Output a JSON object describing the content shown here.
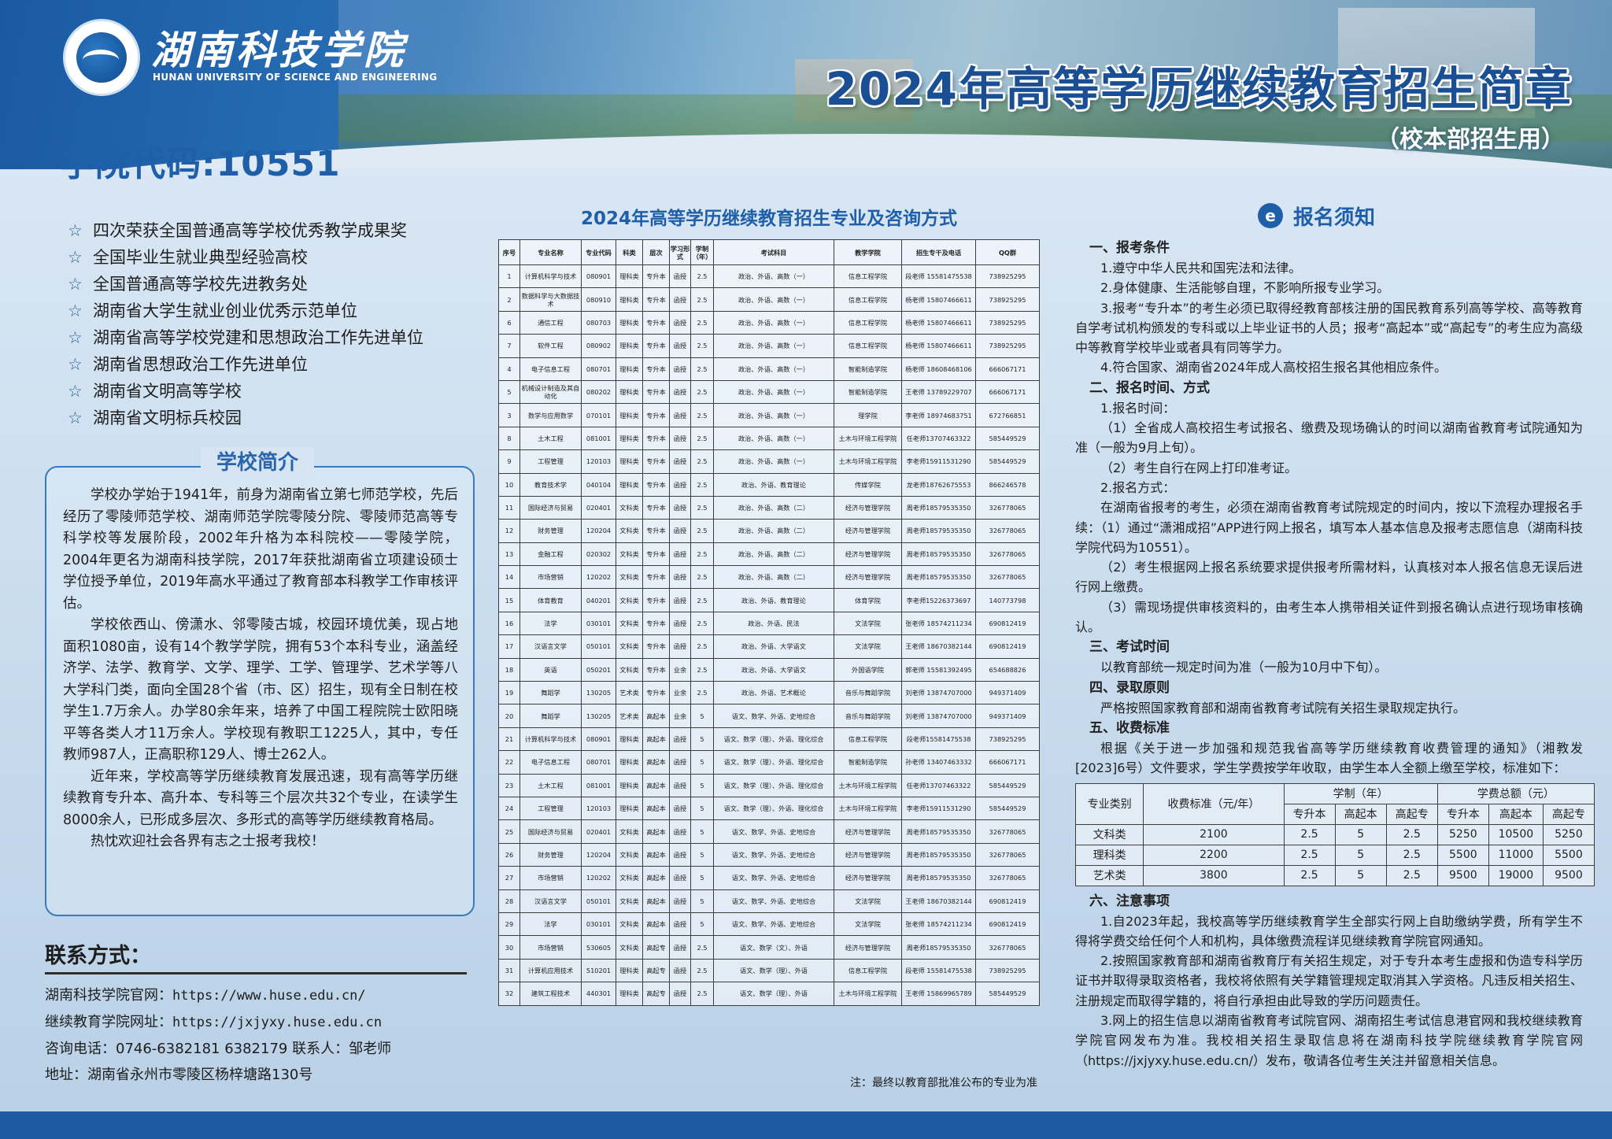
{
  "header": {
    "school_cn": "湖南科技学院",
    "school_en": "HUNAN UNIVERSITY OF SCIENCE AND ENGINEERING",
    "title": "2024年高等学历继续教育招生简章",
    "subtitle": "（校本部招生用）"
  },
  "left": {
    "code_title": "学院代码:10551",
    "honors": [
      "四次荣获全国普通高等学校优秀教学成果奖",
      "全国毕业生就业典型经验高校",
      "全国普通高等学校先进教务处",
      "湖南省大学生就业创业优秀示范单位",
      "湖南省高等学校党建和思想政治工作先进单位",
      "湖南省思想政治工作先进单位",
      "湖南省文明高等学校",
      "湖南省文明标兵校园"
    ],
    "intro_title": "学校简介",
    "intro_paragraphs": [
      "学校办学始于1941年，前身为湖南省立第七师范学校，先后经历了零陵师范学校、湖南师范学院零陵分院、零陵师范高等专科学校等发展阶段，2002年升格为本科院校——零陵学院，2004年更名为湖南科技学院，2017年获批湖南省立项建设硕士学位授予单位，2019年高水平通过了教育部本科教学工作审核评估。",
      "学校依西山、傍潇水、邻零陵古城，校园环境优美，现占地面积1080亩，设有14个教学学院，拥有53个本科专业，涵盖经济学、法学、教育学、文学、理学、工学、管理学、艺术学等八大学科门类，面向全国28个省（市、区）招生，现有全日制在校学生1.7万余人。办学80余年来，培养了中国工程院院士欧阳晓平等各类人才11万余人。学校现有教职工1225人，其中，专任教师987人，正高职称129人、博士262人。",
      "近年来，学校高等学历继续教育发展迅速，现有高等学历继续教育专升本、高升本、专科等三个层次共32个专业，在读学生8000余人，已形成多层次、多形式的高等学历继续教育格局。",
      "热忱欢迎社会各界有志之士报考我校！"
    ],
    "contact_title": "联系方式：",
    "contact": [
      {
        "label": "湖南科技学院官网：",
        "value": "https://www.huse.edu.cn/"
      },
      {
        "label": "继续教育学院网址：",
        "value": "https://jxjyxy.huse.edu.cn"
      },
      {
        "label": "咨询电话：",
        "value": "0746-6382181    6382179    联系人：邹老师"
      },
      {
        "label": "地址：",
        "value": "湖南省永州市零陵区杨梓塘路130号"
      }
    ]
  },
  "table": {
    "title": "2024年高等学历继续教育招生专业及咨询方式",
    "headers": [
      "序号",
      "专业名称",
      "专业代码",
      "科类",
      "层次",
      "学习形式",
      "学制（年）",
      "考试科目",
      "教学学院",
      "招生专干及电话",
      "QQ群"
    ],
    "rows": [
      [
        "1",
        "计算机科学与技术",
        "080901",
        "理科类",
        "专升本",
        "函授",
        "2.5",
        "政治、外语、高数（一）",
        "信息工程学院",
        "段老师 15581475538",
        "738925295"
      ],
      [
        "2",
        "数据科学与大数据技术",
        "080910",
        "理科类",
        "专升本",
        "函授",
        "2.5",
        "政治、外语、高数（一）",
        "信息工程学院",
        "杨老师 15807466611",
        "738925295"
      ],
      [
        "6",
        "通信工程",
        "080703",
        "理科类",
        "专升本",
        "函授",
        "2.5",
        "政治、外语、高数（一）",
        "信息工程学院",
        "杨老师 15807466611",
        "738925295"
      ],
      [
        "7",
        "软件工程",
        "080902",
        "理科类",
        "专升本",
        "函授",
        "2.5",
        "政治、外语、高数（一）",
        "信息工程学院",
        "杨老师 15807466611",
        "738925295"
      ],
      [
        "4",
        "电子信息工程",
        "080701",
        "理科类",
        "专升本",
        "函授",
        "2.5",
        "政治、外语、高数（一）",
        "智能制造学院",
        "杨老师 18608468106",
        "666067171"
      ],
      [
        "5",
        "机械设计制造及其自动化",
        "080202",
        "理科类",
        "专升本",
        "函授",
        "2.5",
        "政治、外语、高数（一）",
        "智能制造学院",
        "王老师 13789229707",
        "666067171"
      ],
      [
        "3",
        "数学与应用数学",
        "070101",
        "理科类",
        "专升本",
        "函授",
        "2.5",
        "政治、外语、高数（一）",
        "理学院",
        "李老师 18974683751",
        "672766851"
      ],
      [
        "8",
        "土木工程",
        "081001",
        "理科类",
        "专升本",
        "函授",
        "2.5",
        "政治、外语、高数（一）",
        "土木与环境工程学院",
        "任老师13707463322",
        "585449529"
      ],
      [
        "9",
        "工程管理",
        "120103",
        "理科类",
        "专升本",
        "函授",
        "2.5",
        "政治、外语、高数（一）",
        "土木与环境工程学院",
        "李老师15911531290",
        "585449529"
      ],
      [
        "10",
        "教育技术学",
        "040104",
        "理科类",
        "专升本",
        "函授",
        "2.5",
        "政治、外语、教育理论",
        "传媒学院",
        "龙老师18762675553",
        "866246578"
      ],
      [
        "11",
        "国际经济与贸易",
        "020401",
        "文科类",
        "专升本",
        "函授",
        "2.5",
        "政治、外语、高数（二）",
        "经济与管理学院",
        "周老师18579535350",
        "326778065"
      ],
      [
        "12",
        "财务管理",
        "120204",
        "文科类",
        "专升本",
        "函授",
        "2.5",
        "政治、外语、高数（二）",
        "经济与管理学院",
        "周老师18579535350",
        "326778065"
      ],
      [
        "13",
        "金融工程",
        "020302",
        "文科类",
        "专升本",
        "函授",
        "2.5",
        "政治、外语、高数（二）",
        "经济与管理学院",
        "周老师18579535350",
        "326778065"
      ],
      [
        "14",
        "市场营销",
        "120202",
        "文科类",
        "专升本",
        "函授",
        "2.5",
        "政治、外语、高数（二）",
        "经济与管理学院",
        "周老师18579535350",
        "326778065"
      ],
      [
        "15",
        "体育教育",
        "040201",
        "文科类",
        "专升本",
        "函授",
        "2.5",
        "政治、外语、教育理论",
        "体育学院",
        "李老师15226373697",
        "140773798"
      ],
      [
        "16",
        "法学",
        "030101",
        "文科类",
        "专升本",
        "函授",
        "2.5",
        "政治、外语、民法",
        "文法学院",
        "张老师 18574211234",
        "690812419"
      ],
      [
        "17",
        "汉语言文学",
        "050101",
        "文科类",
        "专升本",
        "函授",
        "2.5",
        "政治、外语、大学语文",
        "文法学院",
        "王老师 18670382144",
        "690812419"
      ],
      [
        "18",
        "英语",
        "050201",
        "文科类",
        "专升本",
        "业余",
        "2.5",
        "政治、外语、大学语文",
        "外国语学院",
        "郭老师 15581392495",
        "654688826"
      ],
      [
        "19",
        "舞蹈学",
        "130205",
        "艺术类",
        "专升本",
        "业余",
        "2.5",
        "政治、外语、艺术概论",
        "音乐与舞蹈学院",
        "刘老师 13874707000",
        "949371409"
      ],
      [
        "20",
        "舞蹈学",
        "130205",
        "艺术类",
        "高起本",
        "业余",
        "5",
        "语文、数学、外语、史地综合",
        "音乐与舞蹈学院",
        "刘老师 13874707000",
        "949371409"
      ],
      [
        "21",
        "计算机科学与技术",
        "080901",
        "理科类",
        "高起本",
        "函授",
        "5",
        "语文、数学（理）、外语、理化综合",
        "信息工程学院",
        "段老师15581475538",
        "738925295"
      ],
      [
        "22",
        "电子信息工程",
        "080701",
        "理科类",
        "高起本",
        "函授",
        "5",
        "语文、数学（理）、外语、理化综合",
        "智能制造学院",
        "孙老师 13407463332",
        "666067171"
      ],
      [
        "23",
        "土木工程",
        "081001",
        "理科类",
        "高起本",
        "函授",
        "5",
        "语文、数学（理）、外语、理化综合",
        "土木与环境工程学院",
        "任老师13707463322",
        "585449529"
      ],
      [
        "24",
        "工程管理",
        "120103",
        "理科类",
        "高起本",
        "函授",
        "5",
        "语文、数学（理）、外语、理化综合",
        "土木与环境工程学院",
        "李老师15911531290",
        "585449529"
      ],
      [
        "25",
        "国际经济与贸易",
        "020401",
        "文科类",
        "高起本",
        "函授",
        "5",
        "语文、数学、外语、史地综合",
        "经济与管理学院",
        "周老师18579535350",
        "326778065"
      ],
      [
        "26",
        "财务管理",
        "120204",
        "文科类",
        "高起本",
        "函授",
        "5",
        "语文、数学、外语、史地综合",
        "经济与管理学院",
        "周老师18579535350",
        "326778065"
      ],
      [
        "27",
        "市场营销",
        "120202",
        "文科类",
        "高起本",
        "函授",
        "5",
        "语文、数学、外语、史地综合",
        "经济与管理学院",
        "周老师18579535350",
        "326778065"
      ],
      [
        "28",
        "汉语言文学",
        "050101",
        "文科类",
        "高起本",
        "函授",
        "5",
        "语文、数学、外语、史地综合",
        "文法学院",
        "王老师 18670382144",
        "690812419"
      ],
      [
        "29",
        "法学",
        "030101",
        "文科类",
        "高起本",
        "函授",
        "5",
        "语文、数学、外语、史地综合",
        "文法学院",
        "张老师 18574211234",
        "690812419"
      ],
      [
        "30",
        "市场营销",
        "530605",
        "文科类",
        "高起专",
        "函授",
        "2.5",
        "语文、数学（文）、外语",
        "经济与管理学院",
        "周老师18579535350",
        "326778065"
      ],
      [
        "31",
        "计算机应用技术",
        "510201",
        "理科类",
        "高起专",
        "函授",
        "2.5",
        "语文、数学（理）、外语",
        "信息工程学院",
        "段老师 15581475538",
        "738925295"
      ],
      [
        "32",
        "建筑工程技术",
        "440301",
        "理科类",
        "高起专",
        "函授",
        "2.5",
        "语文、数学（理）、外语",
        "土木与环境工程学院",
        "王老师 15869965789",
        "585449529"
      ]
    ],
    "note": "注：最终以教育部批准公布的专业为准"
  },
  "notice": {
    "title": "报名须知",
    "icon": "e-icon",
    "sec1_title": "一、报考条件",
    "sec1": [
      "1.遵守中华人民共和国宪法和法律。",
      "2.身体健康、生活能够自理，不影响所报专业学习。",
      "3.报考“专升本”的考生必须已取得经教育部核注册的国民教育系列高等学校、高等教育自学考试机构颁发的专科或以上毕业证书的人员；报考“高起本”或“高起专”的考生应为高级中等教育学校毕业或者具有同等学力。",
      "4.符合国家、湖南省2024年成人高校招生报名其他相应条件。"
    ],
    "sec2_title": "二、报名时间、方式",
    "sec2": [
      "1.报名时间：",
      "（1）全省成人高校招生考试报名、缴费及现场确认的时间以湖南省教育考试院通知为准（一般为9月上旬）。",
      "（2）考生自行在网上打印准考证。",
      "2.报名方式：",
      "在湖南省报考的考生，必须在湖南省教育考试院规定的时间内，按以下流程办理报名手续：（1）通过“潇湘成招”APP进行网上报名，填写本人基本信息及报考志愿信息（湖南科技学院代码为10551）。",
      "（2）考生根据网上报名系统要求提供报考所需材料，认真核对本人报名信息无误后进行网上缴费。",
      "（3）需现场提供审核资料的，由考生本人携带相关证件到报名确认点进行现场审核确认。"
    ],
    "sec3_title": "三、考试时间",
    "sec3": [
      "以教育部统一规定时间为准（一般为10月中下旬）。"
    ],
    "sec4_title": "四、录取原则",
    "sec4": [
      "严格按照国家教育部和湖南省教育考试院有关招生录取规定执行。"
    ],
    "sec5_title": "五、收费标准",
    "sec5": [
      "根据《关于进一步加强和规范我省高等学历继续教育收费管理的通知》（湘教发[2023]6号）文件要求，学生学费按学年收取，由学生本人全额上缴至学校，标准如下："
    ],
    "fee": {
      "h_major": "专业类别",
      "h_std": "收费标准（元/年）",
      "h_len": "学制（年）",
      "h_total": "学费总额（元）",
      "sub": [
        "专升本",
        "高起本",
        "高起专",
        "专升本",
        "高起本",
        "高起专"
      ],
      "rows": [
        [
          "文科类",
          "2100",
          "2.5",
          "5",
          "2.5",
          "5250",
          "10500",
          "5250"
        ],
        [
          "理科类",
          "2200",
          "2.5",
          "5",
          "2.5",
          "5500",
          "11000",
          "5500"
        ],
        [
          "艺术类",
          "3800",
          "2.5",
          "5",
          "2.5",
          "9500",
          "19000",
          "9500"
        ]
      ]
    },
    "sec6_title": "六、注意事项",
    "sec6": [
      "1.自2023年起，我校高等学历继续教育学生全部实行网上自助缴纳学费，所有学生不得将学费交给任何个人和机构，具体缴费流程详见继续教育学院官网通知。",
      "2.按照国家教育部和湖南省教育厅有关招生规定，对于专升本考生虚报和伪造专科学历证书并取得录取资格者，我校将依照有关学籍管理规定取消其入学资格。凡违反相关招生、注册规定而取得学籍的，将自行承担由此导致的学历问题责任。",
      "3.网上的招生信息以湖南省教育考试院官网、湖南招生考试信息港官网和我校继续教育学院官网发布为准。我校相关招生录取信息将在湖南科技学院继续教育学院官网（https://jxjyxy.huse.edu.cn/）发布，敬请各位考生关注并留意相关信息。"
    ]
  }
}
